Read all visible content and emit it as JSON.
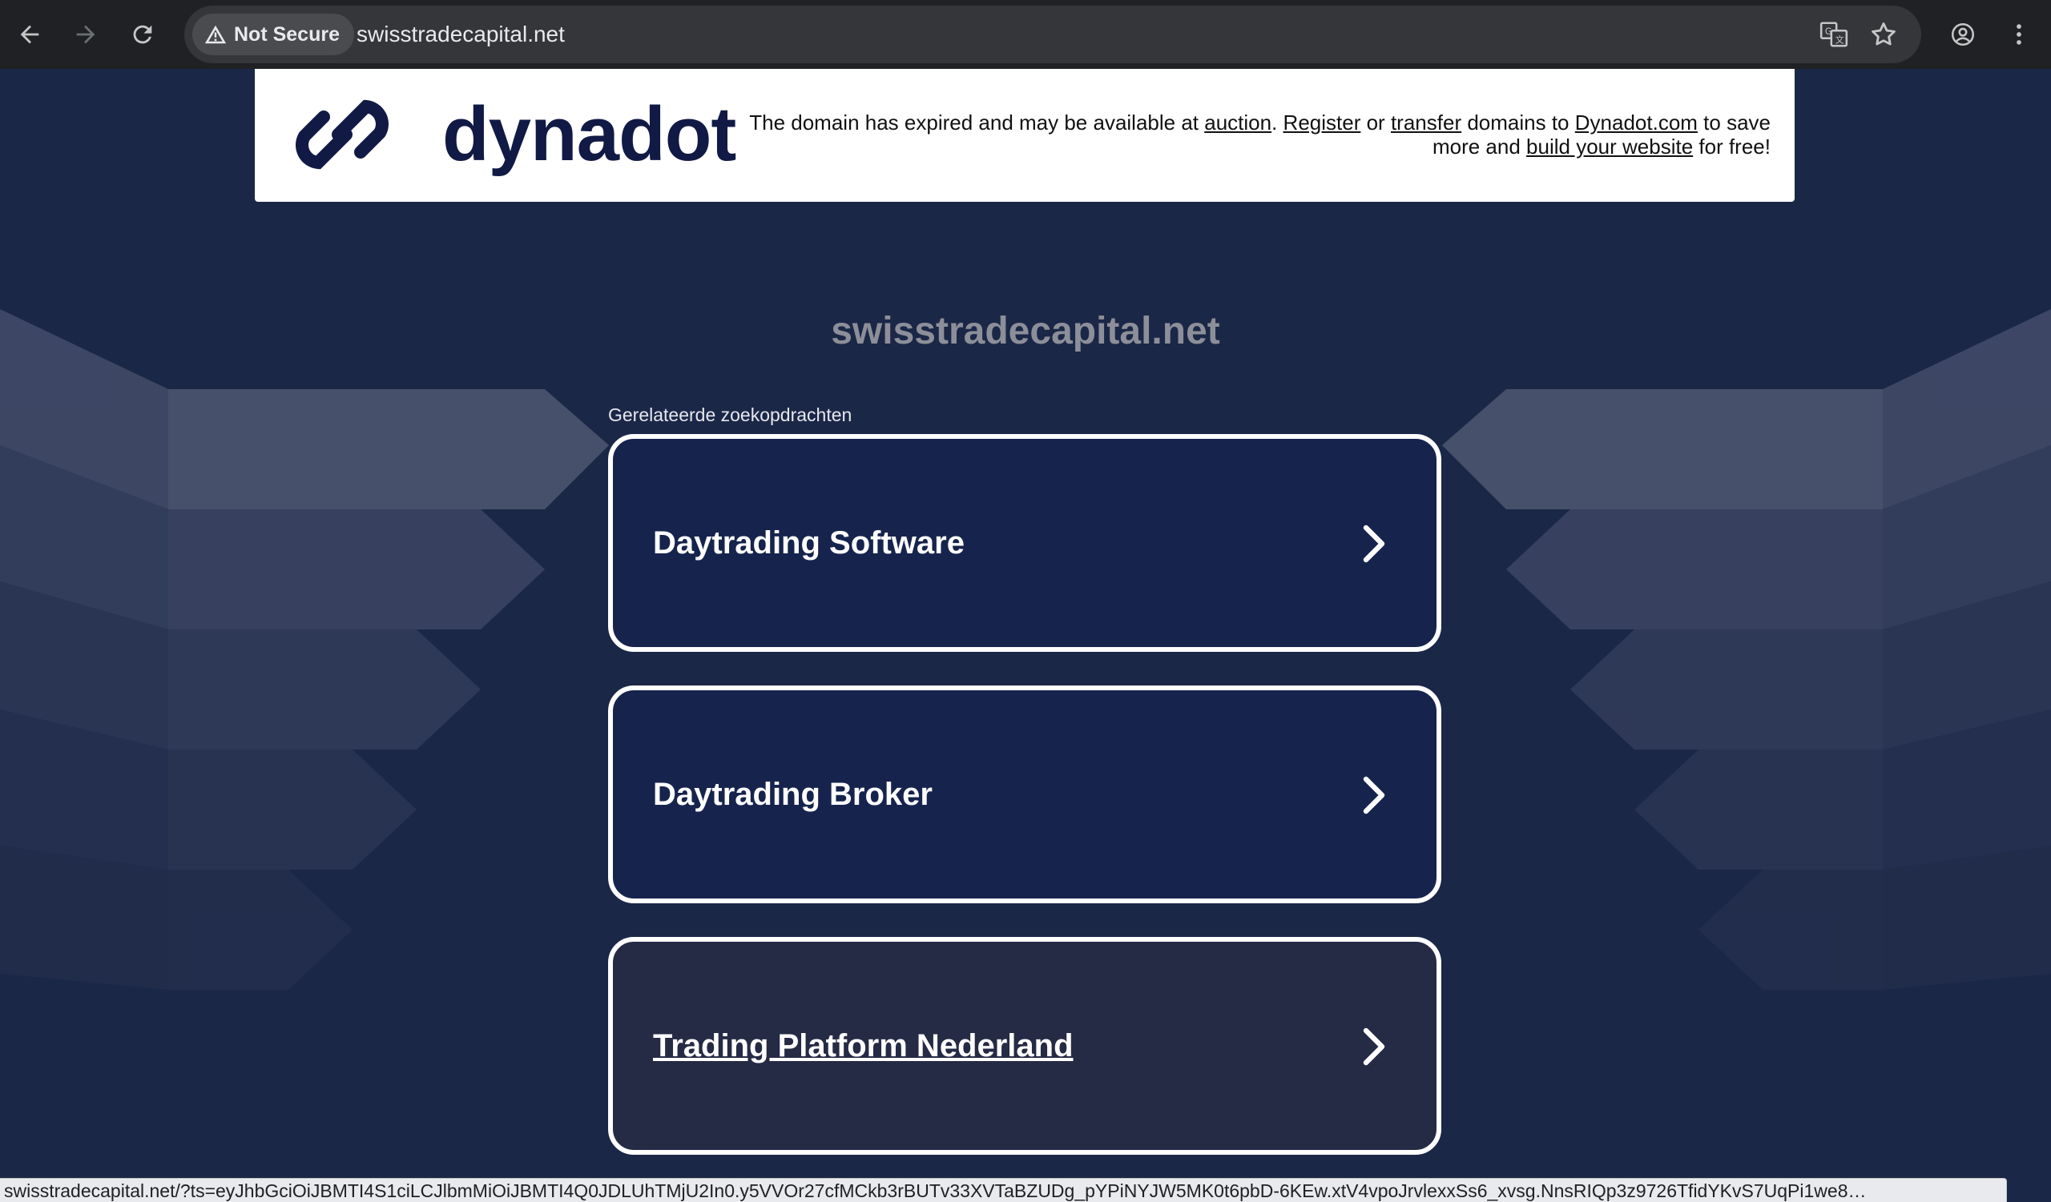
{
  "browser": {
    "security_label": "Not Secure",
    "url": "swisstradecapital.net",
    "status_url": "swisstradecapital.net/?ts=eyJhbGciOiJBMTI4S1ciLCJlbmMiOiJBMTI4Q0JDLUhTMjU2In0.y5VVOr27cfMCkb3rBUTv33XVTaBZUDg_pYPiNYJW5MK0t6pbD-6KEw.xtV4vpoJrvlexxSs6_xvsg.NnsRIQp3z9726TfidYKvS7UqPi1we8…"
  },
  "banner": {
    "logo_text": "dynadot",
    "msg_1": "The domain has expired and may be available at ",
    "link_auction": "auction",
    "msg_2": ". ",
    "link_register": "Register",
    "msg_3": " or ",
    "link_transfer": "transfer",
    "msg_4": " domains to ",
    "link_dynadot": "Dynadot.com",
    "msg_5": " to save more and ",
    "link_build": "build your website",
    "msg_6": " for free!"
  },
  "main": {
    "domain_title": "swisstradecapital.net",
    "related_label": "Gerelateerde zoekopdrachten",
    "cards": [
      {
        "label": "Daytrading Software"
      },
      {
        "label": "Daytrading Broker"
      },
      {
        "label": "Trading Platform Nederland"
      }
    ]
  },
  "icons": [
    "back-arrow-icon",
    "forward-arrow-icon",
    "reload-icon",
    "warning-icon",
    "translate-icon",
    "star-icon",
    "profile-icon",
    "more-vert-icon",
    "chevron-right-icon"
  ]
}
